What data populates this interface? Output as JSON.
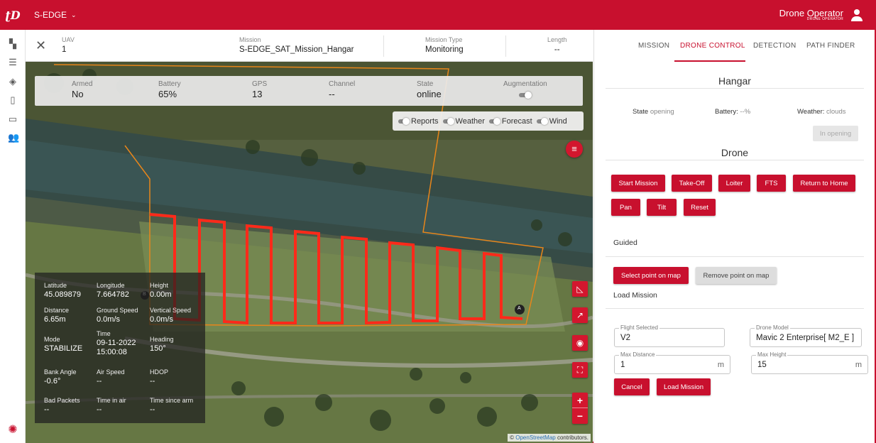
{
  "topbar": {
    "logo": "ʈD",
    "environment": "S-EDGE",
    "user_name": "Drone Operator",
    "user_role": "DRONE OPERATOR"
  },
  "mission_header": {
    "uav_label": "UAV",
    "uav_value": "1",
    "mission_label": "Mission",
    "mission_value": "S-EDGE_SAT_Mission_Hangar",
    "type_label": "Mission Type",
    "type_value": "Monitoring",
    "length_label": "Length",
    "length_value": "--"
  },
  "telemetry": {
    "armed_label": "Armed",
    "armed_value": "No",
    "battery_label": "Battery",
    "battery_value": "65%",
    "gps_label": "GPS",
    "gps_value": "13",
    "channel_label": "Channel",
    "channel_value": "--",
    "state_label": "State",
    "state_value": "online",
    "augmentation_label": "Augmentation"
  },
  "layers": {
    "reports": "Reports",
    "weather": "Weather",
    "forecast": "Forecast",
    "wind": "Wind"
  },
  "stats": {
    "latitude_label": "Latitude",
    "latitude_value": "45.089879",
    "longitude_label": "Longitude",
    "longitude_value": "7.664782",
    "height_label": "Height",
    "height_value": "0.00m",
    "distance_label": "Distance",
    "distance_value": "6.65m",
    "ground_speed_label": "Ground Speed",
    "ground_speed_value": "0.0m/s",
    "vertical_speed_label": "Vertical Speed",
    "vertical_speed_value": "0.0m/s",
    "mode_label": "Mode",
    "mode_value": "STABILIZE",
    "time_label": "Time",
    "time_date": "09-11-2022",
    "time_clock": "15:00:08",
    "heading_label": "Heading",
    "heading_value": "150°",
    "bank_label": "Bank Angle",
    "bank_value": "-0.6°",
    "air_speed_label": "Air Speed",
    "air_speed_value": "--",
    "hdop_label": "HDOP",
    "hdop_value": "--",
    "bad_packets_label": "Bad Packets",
    "bad_packets_value": "--",
    "time_in_air_label": "Time in air",
    "time_in_air_value": "--",
    "time_since_arm_label": "Time since arm",
    "time_since_arm_value": "--"
  },
  "map": {
    "attribution_prefix": "©",
    "attribution_link": "OpenStreetMap",
    "attribution_suffix": "contributors.",
    "marker_a": "A",
    "marker_b": "B"
  },
  "panel": {
    "tabs": [
      "MISSION",
      "DRONE CONTROL",
      "DETECTION",
      "PATH FINDER"
    ],
    "active_tab": "DRONE CONTROL",
    "hangar_title": "Hangar",
    "hangar_state_label": "State",
    "hangar_state_value": "opening",
    "hangar_battery_label": "Battery:",
    "hangar_battery_value": "--%",
    "hangar_weather_label": "Weather:",
    "hangar_weather_value": "clouds",
    "hangar_button": "In opening",
    "drone_title": "Drone",
    "drone_buttons": [
      "Start Mission",
      "Take-Off",
      "Loiter",
      "FTS",
      "Return to Home",
      "Pan",
      "Tilt",
      "Reset"
    ],
    "guided_title": "Guided",
    "select_point": "Select point on map",
    "remove_point": "Remove point on map",
    "load_mission_title": "Load Mission",
    "flight_selected_label": "Flight Selected",
    "flight_selected_value": "V2",
    "drone_model_label": "Drone Model",
    "drone_model_value": "Mavic 2 Enterprise[ M2_E ]",
    "max_distance_label": "Max Distance",
    "max_distance_value": "1",
    "max_distance_unit": "m",
    "max_height_label": "Max Height",
    "max_height_value": "15",
    "max_height_unit": "m",
    "cancel": "Cancel",
    "load_mission": "Load Mission"
  },
  "colors": {
    "brand": "#c8102e",
    "path": "#ff2a1a",
    "geofence": "#e8861a"
  },
  "icons": [
    "dashboard-icon",
    "list-icon",
    "layers-icon",
    "map-icon",
    "monitor-icon",
    "users-icon",
    "brand-icon",
    "close-icon",
    "chevron-down-icon",
    "user-icon",
    "menu-icon",
    "ruler-icon",
    "chart-icon",
    "locate-icon",
    "fit-icon",
    "zoom-in-icon",
    "zoom-out-icon"
  ]
}
